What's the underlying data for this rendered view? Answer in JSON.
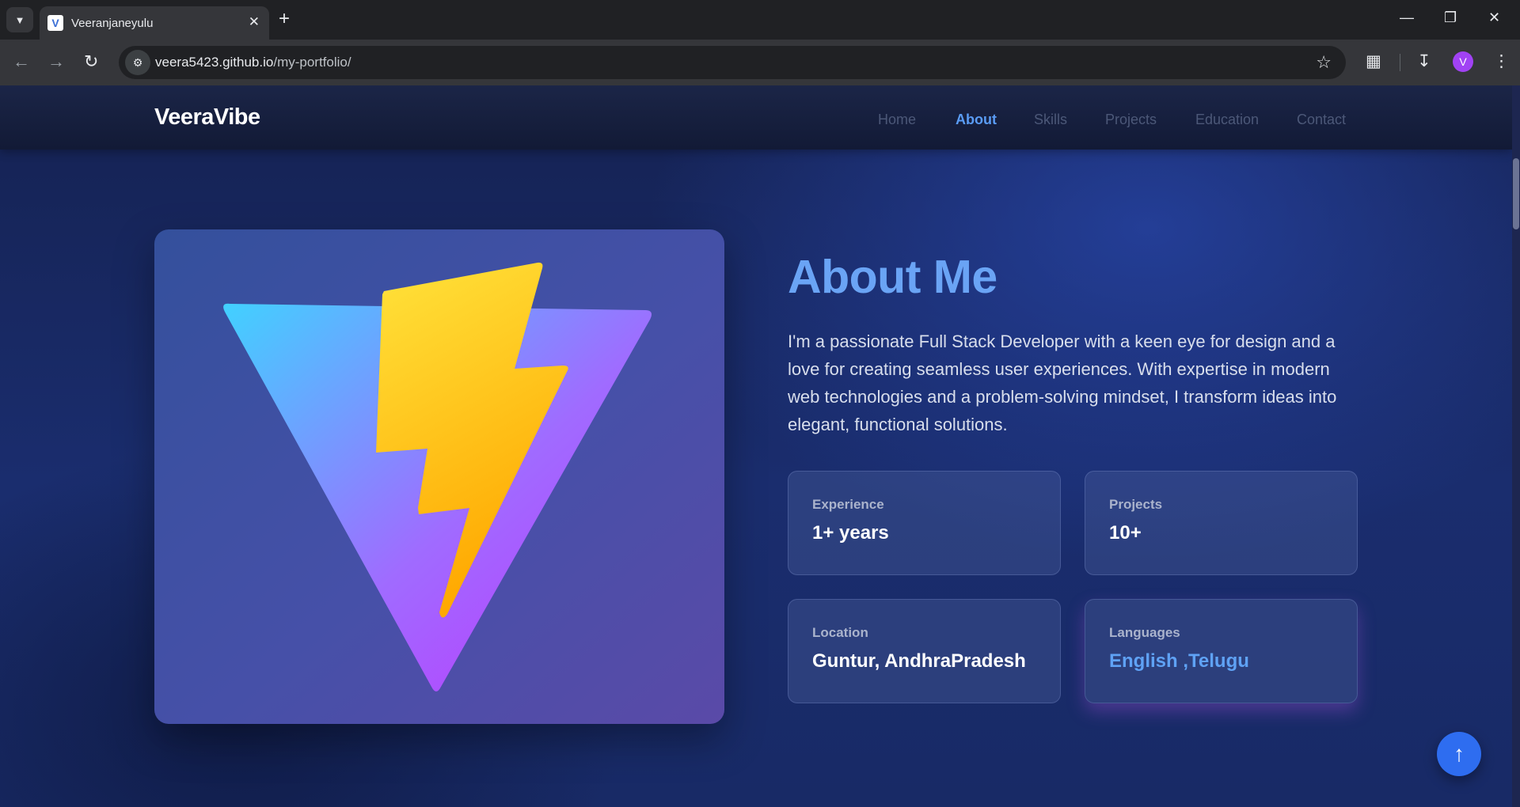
{
  "browser": {
    "tab_title": "Veeranjaneyulu",
    "tab_favicon_letter": "V",
    "url_host": "veera5423.github.io",
    "url_path": "/my-portfolio/",
    "profile_letter": "V"
  },
  "site": {
    "brand": "VeeraVibe",
    "nav": [
      {
        "label": "Home",
        "active": false
      },
      {
        "label": "About",
        "active": true
      },
      {
        "label": "Skills",
        "active": false
      },
      {
        "label": "Projects",
        "active": false
      },
      {
        "label": "Education",
        "active": false
      },
      {
        "label": "Contact",
        "active": false
      }
    ]
  },
  "about": {
    "title": "About Me",
    "description": "I'm a passionate Full Stack Developer with a keen eye for design and a love for creating seamless user experiences. With expertise in modern web technologies and a problem-solving mindset, I transform ideas into elegant, functional solutions.",
    "stats": [
      {
        "label": "Experience",
        "value": "1+ years"
      },
      {
        "label": "Projects",
        "value": "10+"
      },
      {
        "label": "Location",
        "value": "Guntur, AndhraPradesh"
      },
      {
        "label": "Languages",
        "value": "English ,Telugu"
      }
    ]
  },
  "icons": {
    "scroll_top": "arrow-up-icon",
    "hero_image": "vite-logo"
  },
  "colors": {
    "accent": "#5a9cf5",
    "scroll_button": "#2e6df0"
  }
}
